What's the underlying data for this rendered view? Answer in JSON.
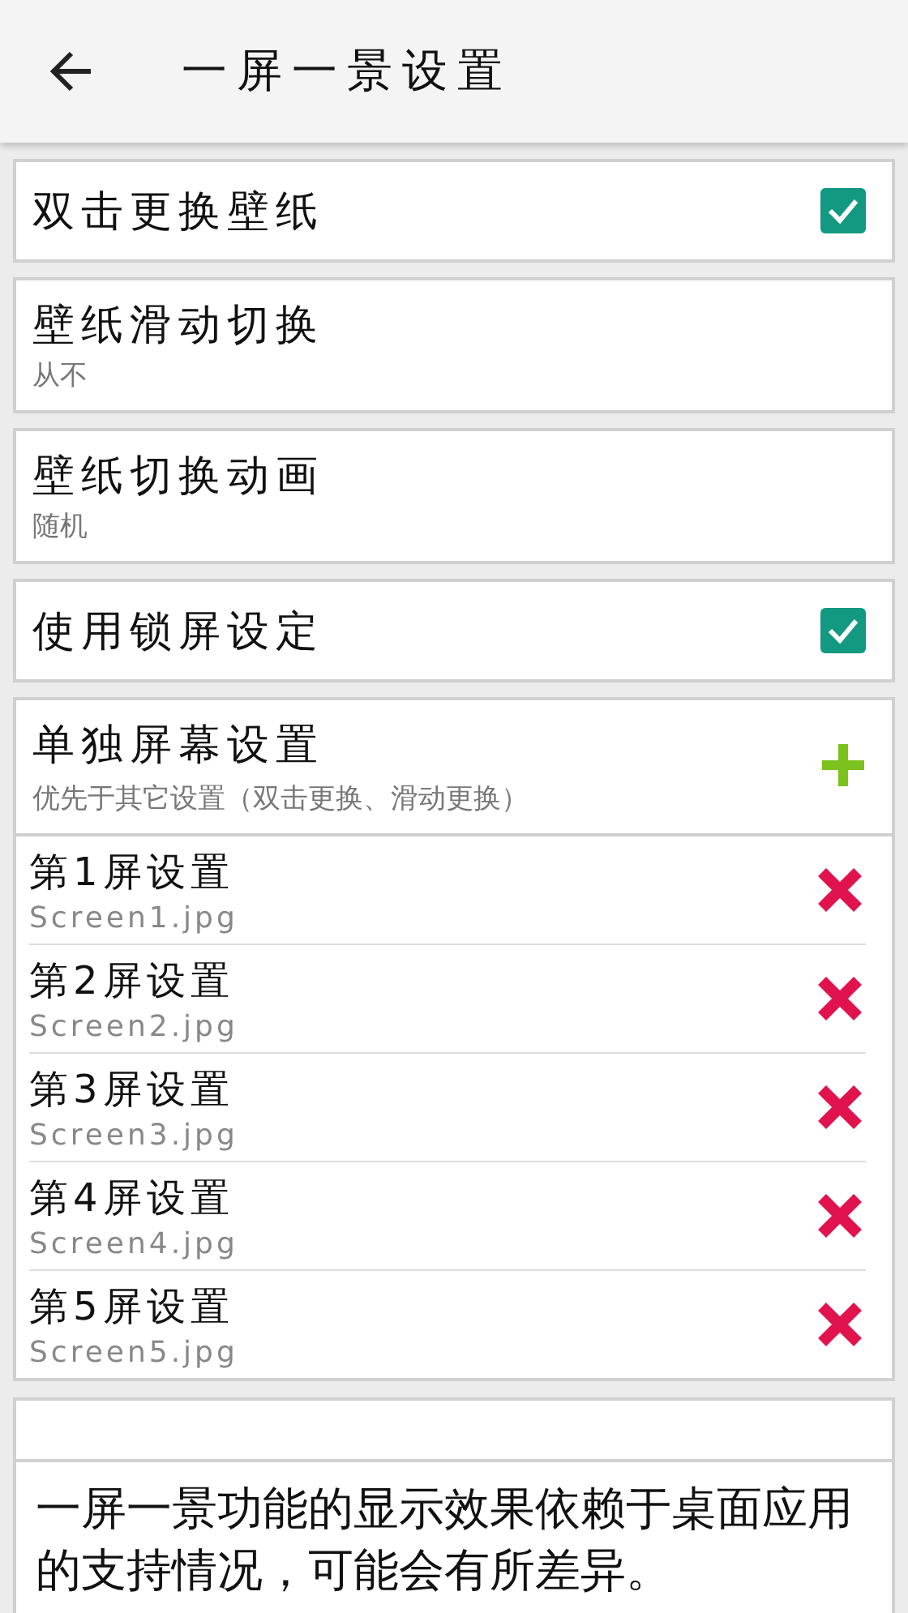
{
  "header": {
    "title": "一屏一景设置"
  },
  "settings": [
    {
      "kind": "checkbox",
      "title": "双击更换壁纸",
      "checked": true
    },
    {
      "kind": "value",
      "title": "壁纸滑动切换",
      "value": "从不"
    },
    {
      "kind": "value",
      "title": "壁纸切换动画",
      "value": "随机"
    },
    {
      "kind": "checkbox",
      "title": "使用锁屏设定",
      "checked": true
    }
  ],
  "screen_group": {
    "title": "单独屏幕设置",
    "subtitle": "优先于其它设置（双击更换、滑动更换）",
    "screens": [
      {
        "title": "第1屏设置",
        "file": "Screen1.jpg"
      },
      {
        "title": "第2屏设置",
        "file": "Screen2.jpg"
      },
      {
        "title": "第3屏设置",
        "file": "Screen3.jpg"
      },
      {
        "title": "第4屏设置",
        "file": "Screen4.jpg"
      },
      {
        "title": "第5屏设置",
        "file": "Screen5.jpg"
      }
    ]
  },
  "note": {
    "text": "一屏一景功能的显示效果依赖于桌面应用的支持情况，可能会有所差异。"
  }
}
